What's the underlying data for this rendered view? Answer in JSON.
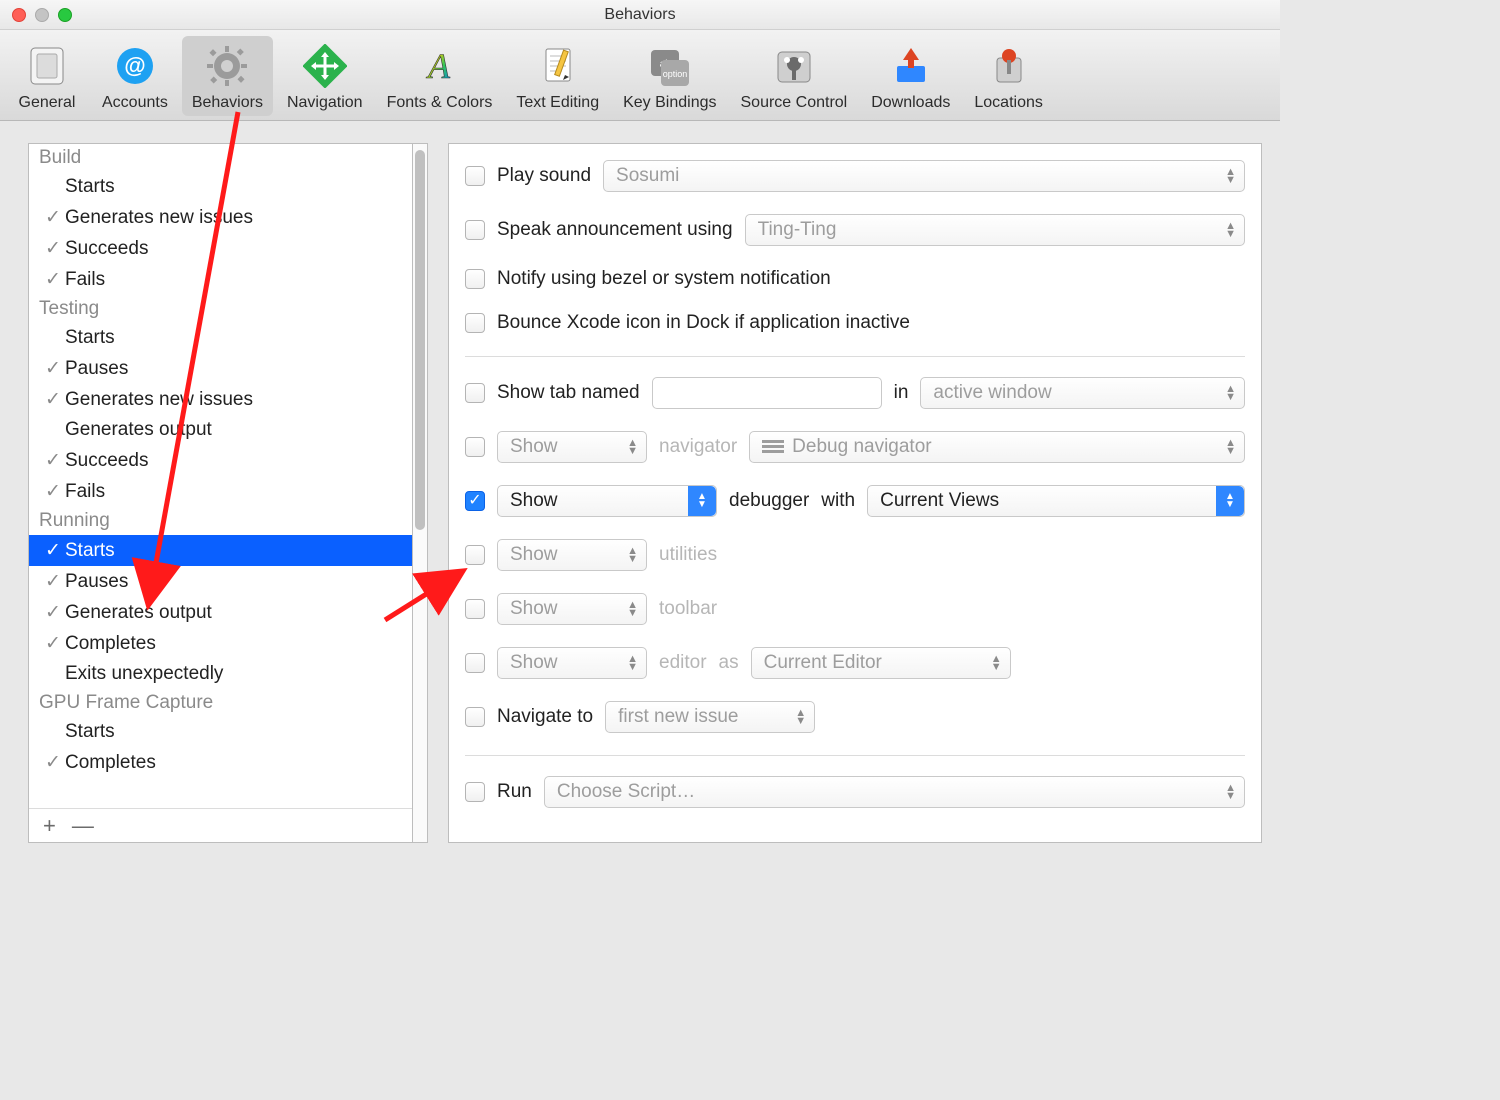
{
  "window": {
    "title": "Behaviors"
  },
  "toolbar": {
    "items": [
      {
        "label": "General"
      },
      {
        "label": "Accounts"
      },
      {
        "label": "Behaviors"
      },
      {
        "label": "Navigation"
      },
      {
        "label": "Fonts & Colors"
      },
      {
        "label": "Text Editing"
      },
      {
        "label": "Key Bindings"
      },
      {
        "label": "Source Control"
      },
      {
        "label": "Downloads"
      },
      {
        "label": "Locations"
      }
    ],
    "selected_index": 2
  },
  "sidebar": {
    "groups": [
      {
        "header": "Build",
        "items": [
          {
            "label": "Starts",
            "checked": false
          },
          {
            "label": "Generates new issues",
            "checked": true
          },
          {
            "label": "Succeeds",
            "checked": true
          },
          {
            "label": "Fails",
            "checked": true
          }
        ]
      },
      {
        "header": "Testing",
        "items": [
          {
            "label": "Starts",
            "checked": false
          },
          {
            "label": "Pauses",
            "checked": true
          },
          {
            "label": "Generates new issues",
            "checked": true
          },
          {
            "label": "Generates output",
            "checked": false
          },
          {
            "label": "Succeeds",
            "checked": true
          },
          {
            "label": "Fails",
            "checked": true
          }
        ]
      },
      {
        "header": "Running",
        "items": [
          {
            "label": "Starts",
            "checked": true,
            "selected": true
          },
          {
            "label": "Pauses",
            "checked": true
          },
          {
            "label": "Generates output",
            "checked": true
          },
          {
            "label": "Completes",
            "checked": true
          },
          {
            "label": "Exits unexpectedly",
            "checked": false
          }
        ]
      },
      {
        "header": "GPU Frame Capture",
        "items": [
          {
            "label": "Starts",
            "checked": false
          },
          {
            "label": "Completes",
            "checked": true
          }
        ]
      }
    ],
    "footer": {
      "add": "+",
      "remove": "—"
    }
  },
  "panel": {
    "play_sound": {
      "label": "Play sound",
      "value": "Sosumi"
    },
    "speak": {
      "label": "Speak announcement using",
      "value": "Ting-Ting"
    },
    "notify": {
      "label": "Notify using bezel or system notification"
    },
    "bounce": {
      "label": "Bounce Xcode icon in Dock if application inactive"
    },
    "show_tab": {
      "label": "Show tab named",
      "in": "in",
      "window": "active window"
    },
    "navigator": {
      "action": "Show",
      "label": "navigator",
      "value": "Debug navigator"
    },
    "debugger": {
      "action": "Show",
      "label": "debugger",
      "with": "with",
      "value": "Current Views"
    },
    "utilities": {
      "action": "Show",
      "label": "utilities"
    },
    "toolbar_row": {
      "action": "Show",
      "label": "toolbar"
    },
    "editor": {
      "action": "Show",
      "label": "editor",
      "as": "as",
      "value": "Current Editor"
    },
    "navigate": {
      "label": "Navigate to",
      "value": "first new issue"
    },
    "run": {
      "label": "Run",
      "value": "Choose Script…"
    }
  }
}
